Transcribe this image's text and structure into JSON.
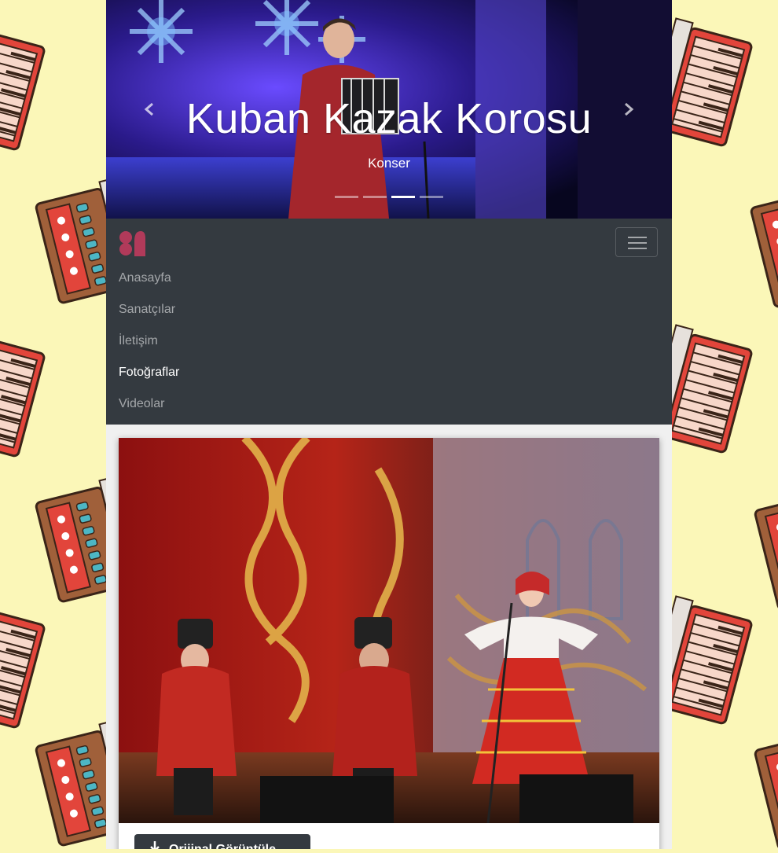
{
  "carousel": {
    "title": "Kuban Kazak Korosu",
    "subtitle": "Konser",
    "active_index": 2,
    "slide_count": 4
  },
  "navbar": {
    "items": [
      {
        "label": "Anasayfa",
        "active": false
      },
      {
        "label": "Sanatçılar",
        "active": false
      },
      {
        "label": "İletişim",
        "active": false
      },
      {
        "label": "Fotoğraflar",
        "active": true
      },
      {
        "label": "Videolar",
        "active": false
      }
    ]
  },
  "photo": {
    "download_label": "Orijinal Görüntüle"
  },
  "colors": {
    "page_background": "#fbf7b8",
    "navbar": "#343a40",
    "logo": "#b13a5a",
    "accordion_red": "#e2453b"
  },
  "icons": [
    "chevron-left-icon",
    "chevron-right-icon",
    "hamburger-icon",
    "download-icon",
    "site-logo"
  ]
}
